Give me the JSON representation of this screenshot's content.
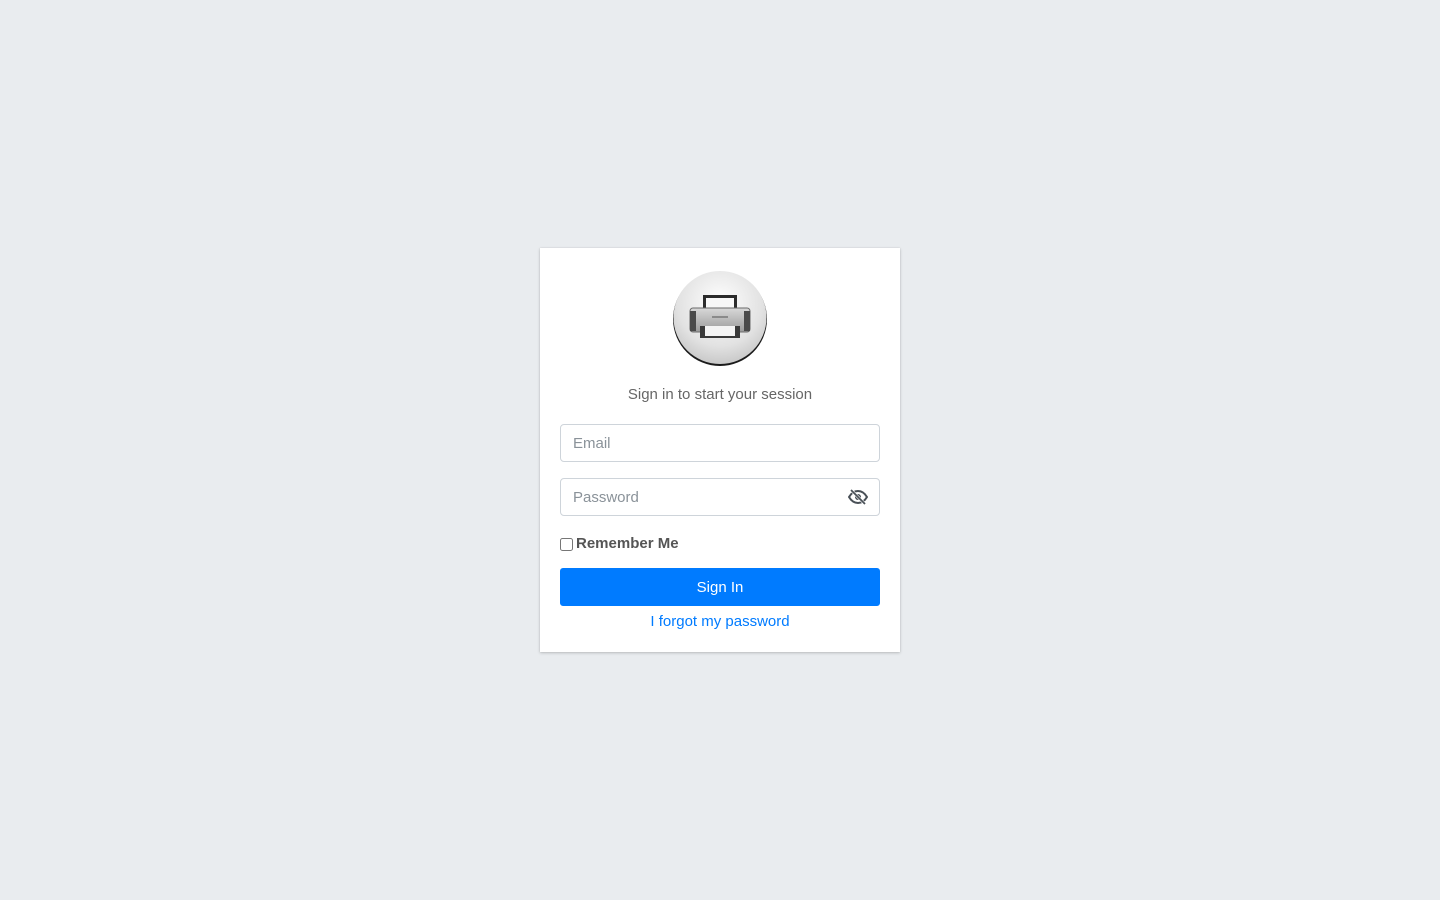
{
  "login": {
    "logo_icon": "printer-icon",
    "message": "Sign in to start your session",
    "email": {
      "value": "",
      "placeholder": "Email"
    },
    "password": {
      "value": "",
      "placeholder": "Password",
      "toggle_icon": "eye-slash-icon"
    },
    "remember_label": "Remember Me",
    "remember_checked": false,
    "signin_label": "Sign In",
    "forgot_label": "I forgot my password"
  },
  "colors": {
    "page_background": "#e9ecef",
    "card_background": "#ffffff",
    "primary": "#007bff",
    "text": "#495057"
  }
}
